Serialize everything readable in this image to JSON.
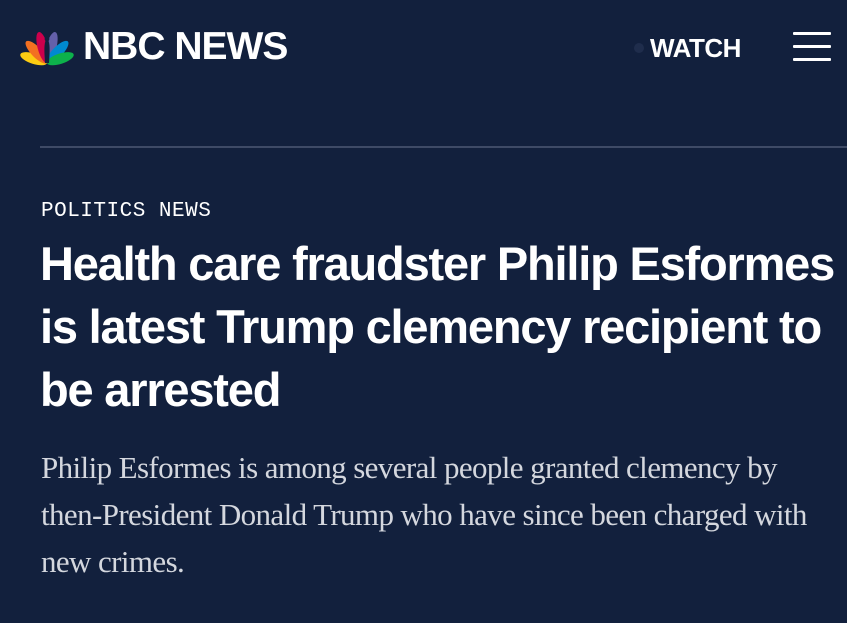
{
  "header": {
    "logo_text": "NBC NEWS",
    "watch_label": "WATCH",
    "peacock_icon": "peacock-logo-icon",
    "menu_icon": "hamburger-menu-icon"
  },
  "article": {
    "category": "POLITICS NEWS",
    "headline": "Health care fraudster Philip Esformes is latest Trump clemency recipient to be arrested",
    "dek": "Philip Esformes is among several people granted clemency by then-President Donald Trump who have since been charged with new crimes."
  },
  "colors": {
    "background": "#12203d",
    "text": "#ffffff",
    "dek_text": "#d4d7de",
    "divider": "#3e4a66",
    "peacock": [
      "#fccc12",
      "#f37021",
      "#cc004c",
      "#6460aa",
      "#0089d0",
      "#0db14b"
    ]
  }
}
